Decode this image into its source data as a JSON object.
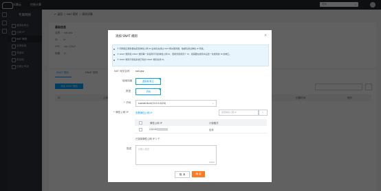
{
  "topbar": {
    "brand": "天翼云",
    "nav": "控制计算",
    "search_placeholder": "搜索"
  },
  "sidebar": {
    "title": "专属网络",
    "items": [
      {
        "label": "虚拟私有云"
      },
      {
        "label": "公网 IP"
      },
      {
        "label": "NAT 网关"
      },
      {
        "label": "共享带宽"
      },
      {
        "label": "流量包"
      },
      {
        "label": "安全组"
      },
      {
        "label": "边缘云专线"
      }
    ],
    "active_index": 2
  },
  "breadcrumb": {
    "back": "返回",
    "section": "NAT 网关",
    "current": "网关详情"
  },
  "detail": {
    "section_title": "基础信息",
    "rows": [
      {
        "label": "名称",
        "value": "nat-gw"
      },
      {
        "label": "ID",
        "value": "nt"
      },
      {
        "label": "VPC",
        "value": "vpc-22p9"
      },
      {
        "label": "规格",
        "value": "小"
      }
    ]
  },
  "tabs": [
    {
      "label": "SNAT 规则"
    },
    {
      "label": "DNAT 规则"
    }
  ],
  "list": {
    "add_button": "添加 SNAT 规则",
    "columns": [
      "ID",
      "公网IP",
      "源网段",
      "状态",
      "描述",
      "创建时间",
      "操作"
    ]
  },
  "dialog": {
    "title": "添加 SNAT 规则",
    "close": "×",
    "info_lines": [
      "① 同网络云服务器在配置弹性公网 IP 后将优先通过 NAT 网关服务器，数据包通过弹性 IP 转发。",
      "② SNAT 规则和 DNAT 规则每一条使用不同的弹性公网 IP，若希望使用同个 IP，就需要在规则中设置一条规则的 IP 的端口。",
      "③ SNAT 规则不能和系统已有的 DNAT 规则共用 IP。"
    ],
    "gateway_label": "NAT 网关名称",
    "gateway_value": "nat-gw",
    "scenario_label": "使用场景",
    "scenario_value": "虚拟私有云",
    "type_label": "类型",
    "type_value": "子网",
    "subnet_label": "子网",
    "subnet_value": "subnet-6vr4(10.0.0.0/24)",
    "eip_label": "弹性公网 IP",
    "eip_link": "查看弹性公网 IP",
    "eip_search_placeholder": "搜索弹性公网 IP",
    "eip_table": {
      "columns": [
        "弹性公网 IP",
        "计费模式"
      ],
      "rows": [
        {
          "ip": "218.80",
          "billing": "包年"
        }
      ]
    },
    "selected_text": "已选择弹性公网 IP 1 个",
    "desc_label": "描述",
    "desc_placeholder": "请输入描述",
    "desc_counter": "0/255",
    "cancel": "取 消",
    "ok": "确 定"
  },
  "colors": {
    "accent": "#00a4ff",
    "primary_button": "#ff7a20",
    "overlay": "#000000"
  }
}
